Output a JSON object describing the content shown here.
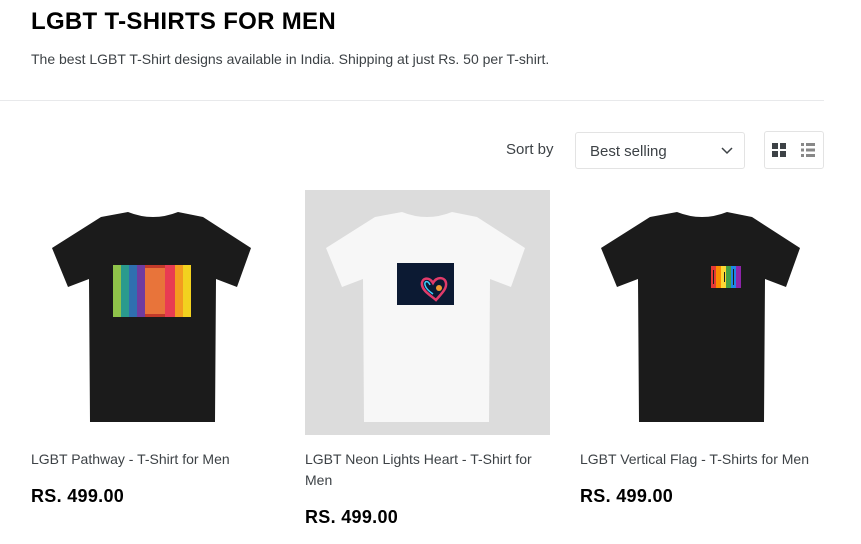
{
  "page": {
    "title": "LGBT T-SHIRTS FOR MEN",
    "subtitle": "The best LGBT T-Shirt designs available in India. Shipping at just Rs. 50 per T-shirt."
  },
  "toolbar": {
    "sort_label": "Sort by",
    "sort_value": "Best selling",
    "view_grid_icon": "grid-icon",
    "view_list_icon": "list-icon"
  },
  "products": [
    {
      "name": "LGBT Pathway - T-Shirt for Men",
      "price": "RS. 499.00",
      "shirt_color": "#1b1b1b",
      "bg": "#ffffff"
    },
    {
      "name": "LGBT Neon Lights Heart - T-Shirt for Men",
      "price": "RS. 499.00",
      "shirt_color": "#f7f7f7",
      "bg": "#dcdcdc"
    },
    {
      "name": "LGBT Vertical Flag - T-Shirts for Men",
      "price": "RS. 499.00",
      "shirt_color": "#1b1b1b",
      "bg": "#ffffff"
    }
  ]
}
